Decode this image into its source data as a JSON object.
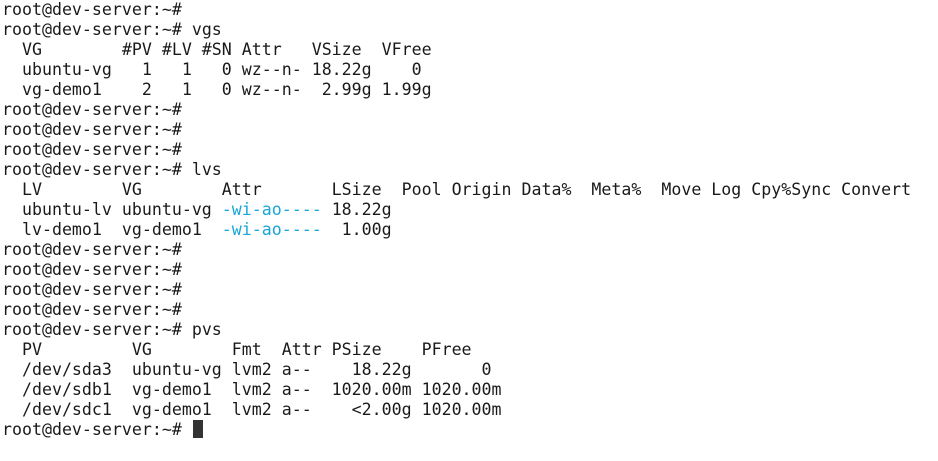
{
  "prompt": "root@dev-server:~#",
  "colors": {
    "background": "#ffffff",
    "text": "#1a1a1a",
    "lv_attr": "#1aa6d8",
    "cursor": "#333333"
  },
  "lines": [
    {
      "type": "prompt",
      "cmd": ""
    },
    {
      "type": "prompt",
      "cmd": "vgs"
    },
    {
      "type": "row",
      "cells": [
        "  VG        #PV #LV #SN Attr   VSize  VFree"
      ]
    },
    {
      "type": "row",
      "cells": [
        "  ubuntu-vg   1   1   0 wz--n- 18.22g    0"
      ]
    },
    {
      "type": "row",
      "cells": [
        "  vg-demo1    2   1   0 wz--n-  2.99g 1.99g"
      ]
    },
    {
      "type": "prompt",
      "cmd": ""
    },
    {
      "type": "prompt",
      "cmd": ""
    },
    {
      "type": "prompt",
      "cmd": ""
    },
    {
      "type": "prompt",
      "cmd": "lvs"
    },
    {
      "type": "row",
      "cells": [
        "  LV        VG        Attr       LSize  Pool Origin Data%  Meta%  Move Log Cpy%Sync Convert"
      ]
    },
    {
      "type": "row",
      "cells": [
        "  ubuntu-lv ubuntu-vg ",
        "-wi-ao----",
        " 18.22g"
      ]
    },
    {
      "type": "row",
      "cells": [
        "  lv-demo1  vg-demo1  ",
        "-wi-ao----",
        "  1.00g"
      ]
    },
    {
      "type": "prompt",
      "cmd": ""
    },
    {
      "type": "prompt",
      "cmd": ""
    },
    {
      "type": "prompt",
      "cmd": ""
    },
    {
      "type": "prompt",
      "cmd": ""
    },
    {
      "type": "prompt",
      "cmd": "pvs"
    },
    {
      "type": "row",
      "cells": [
        "  PV         VG        Fmt  Attr PSize    PFree"
      ]
    },
    {
      "type": "row",
      "cells": [
        "  /dev/sda3  ubuntu-vg lvm2 a--    18.22g       0"
      ]
    },
    {
      "type": "row",
      "cells": [
        "  /dev/sdb1  vg-demo1  lvm2 a--  1020.00m 1020.00m"
      ]
    },
    {
      "type": "row",
      "cells": [
        "  /dev/sdc1  vg-demo1  lvm2 a--    <2.00g 1020.00m"
      ]
    },
    {
      "type": "prompt",
      "cmd": "",
      "cursor": true
    }
  ]
}
